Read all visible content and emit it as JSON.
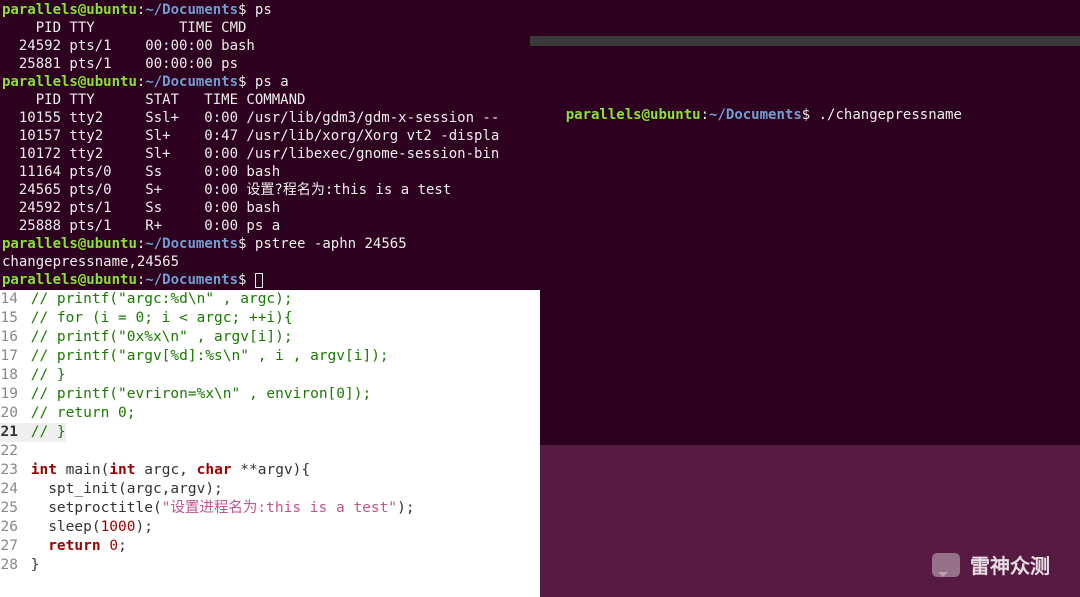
{
  "prompt": {
    "user": "parallels",
    "at": "@",
    "host": "ubuntu",
    "colon": ":",
    "path": "~/Documents",
    "dollar": "$"
  },
  "left_terminal": {
    "lines": [
      {
        "type": "prompt",
        "cmd": "ps"
      },
      {
        "type": "out",
        "text": "    PID TTY          TIME CMD"
      },
      {
        "type": "out",
        "text": "  24592 pts/1    00:00:00 bash"
      },
      {
        "type": "out",
        "text": "  25881 pts/1    00:00:00 ps"
      },
      {
        "type": "prompt",
        "cmd": "ps a"
      },
      {
        "type": "out",
        "text": "    PID TTY      STAT   TIME COMMAND"
      },
      {
        "type": "out",
        "text": "  10155 tty2     Ssl+   0:00 /usr/lib/gdm3/gdm-x-session --"
      },
      {
        "type": "out",
        "text": "  10157 tty2     Sl+    0:47 /usr/lib/xorg/Xorg vt2 -displa"
      },
      {
        "type": "out",
        "text": "  10172 tty2     Sl+    0:00 /usr/libexec/gnome-session-bin"
      },
      {
        "type": "out",
        "text": "  11164 pts/0    Ss     0:00 bash"
      },
      {
        "type": "out",
        "text": "  24565 pts/0    S+     0:00 设置?程名为:this is a test"
      },
      {
        "type": "out",
        "text": "  24592 pts/1    Ss     0:00 bash"
      },
      {
        "type": "out",
        "text": "  25888 pts/1    R+     0:00 ps a"
      },
      {
        "type": "prompt",
        "cmd": "pstree -aphn 24565"
      },
      {
        "type": "out",
        "text": "changepressname,24565"
      },
      {
        "type": "prompt",
        "cmd": "",
        "cursor": true
      }
    ]
  },
  "right_terminal": {
    "cmd": "./changepressname"
  },
  "editor": {
    "lines": [
      {
        "n": 14,
        "seg": [
          {
            "c": "cmnt",
            "t": "// printf(\"argc:%d\\n\" , argc);"
          }
        ]
      },
      {
        "n": 15,
        "seg": [
          {
            "c": "cmnt",
            "t": "// for (i = 0; i < argc; ++i){"
          }
        ]
      },
      {
        "n": 16,
        "seg": [
          {
            "c": "cmnt",
            "t": "// printf(\"0x%x\\n\" , argv[i]);"
          }
        ]
      },
      {
        "n": 17,
        "seg": [
          {
            "c": "cmnt",
            "t": "// printf(\"argv[%d]:%s\\n\" , i , argv[i]);"
          }
        ]
      },
      {
        "n": 18,
        "seg": [
          {
            "c": "cmnt",
            "t": "// }"
          }
        ]
      },
      {
        "n": 19,
        "seg": [
          {
            "c": "cmnt",
            "t": "// printf(\"evriron=%x\\n\" , environ[0]);"
          }
        ]
      },
      {
        "n": 20,
        "seg": [
          {
            "c": "cmnt",
            "t": "// return 0;"
          }
        ]
      },
      {
        "n": 21,
        "hl": true,
        "seg": [
          {
            "c": "cmnt",
            "t": "// }"
          }
        ]
      },
      {
        "n": 22,
        "seg": []
      },
      {
        "n": 23,
        "seg": [
          {
            "c": "type",
            "t": "int"
          },
          {
            "c": "",
            "t": " main("
          },
          {
            "c": "type",
            "t": "int"
          },
          {
            "c": "",
            "t": " argc, "
          },
          {
            "c": "type",
            "t": "char"
          },
          {
            "c": "",
            "t": " **argv){"
          }
        ]
      },
      {
        "n": 24,
        "seg": [
          {
            "c": "",
            "t": "  spt_init(argc,argv);"
          }
        ]
      },
      {
        "n": 25,
        "seg": [
          {
            "c": "",
            "t": "  setproctitle("
          },
          {
            "c": "str",
            "t": "\"设置进程名为:this is a test\""
          },
          {
            "c": "",
            "t": ");"
          }
        ]
      },
      {
        "n": 26,
        "seg": [
          {
            "c": "",
            "t": "  sleep("
          },
          {
            "c": "num",
            "t": "1000"
          },
          {
            "c": "",
            "t": ");"
          }
        ]
      },
      {
        "n": 27,
        "seg": [
          {
            "c": "",
            "t": "  "
          },
          {
            "c": "kw",
            "t": "return"
          },
          {
            "c": "",
            "t": " "
          },
          {
            "c": "num",
            "t": "0"
          },
          {
            "c": "",
            "t": ";"
          }
        ]
      },
      {
        "n": 28,
        "seg": [
          {
            "c": "",
            "t": "}"
          }
        ]
      }
    ]
  },
  "watermark": "雷神众测"
}
